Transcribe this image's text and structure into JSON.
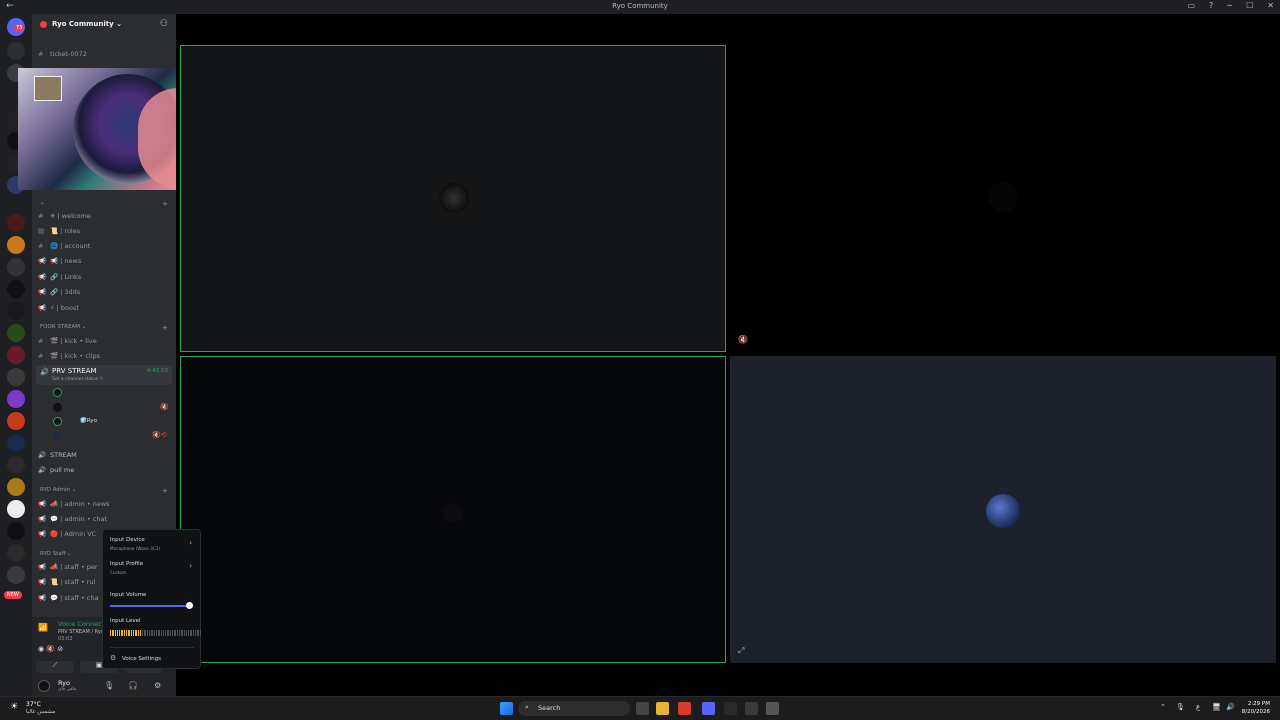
{
  "titlebar": {
    "title": "Ryo Community",
    "back": "←",
    "controls": [
      "▭",
      "?",
      "─",
      "☐",
      "✕"
    ]
  },
  "guild": {
    "name": "Ryo Community ⌄"
  },
  "channels_top": [
    {
      "label": "ticket-0072"
    }
  ],
  "channels_main": [
    {
      "pre": "#",
      "label": "✈ | welcome"
    },
    {
      "pre": "▤",
      "label": "📜 | roles"
    },
    {
      "pre": "#",
      "label": "🌐 | account"
    },
    {
      "pre": "📢",
      "label": "📢 | news"
    },
    {
      "pre": "📢",
      "label": "🔗 | Links"
    },
    {
      "pre": "📢",
      "label": "🔗 | 3dds"
    },
    {
      "pre": "📢",
      "label": "⚡ | boost"
    }
  ],
  "category_stream": {
    "label": "FOOR STREAM ⌄",
    "plus": "+"
  },
  "channels_stream": [
    {
      "pre": "#",
      "label": "🎬 | kick • live"
    },
    {
      "pre": "#",
      "label": "🎬 | kick • clips"
    }
  ],
  "prv_stream": {
    "name": "PRV STREAM",
    "status": "Set a channel status ✎",
    "time": "4:43:03",
    "icon": "🔊"
  },
  "voice_members": [
    {
      "name": ""
    },
    {
      "name": ""
    },
    {
      "name": "🧊Ryo"
    },
    {
      "name": ""
    }
  ],
  "voice_channels": [
    {
      "pre": "🔊",
      "label": "STREAM"
    },
    {
      "pre": "🔊",
      "label": "pull me"
    }
  ],
  "category_admin": {
    "label": "RYO Admin ⌄",
    "plus": "+"
  },
  "channels_admin": [
    {
      "pre": "📢",
      "label": "📣 | admin • news"
    },
    {
      "pre": "📢",
      "label": "💬 | admin • chat"
    },
    {
      "pre": "📢",
      "label": "🔴 | Admin VC"
    }
  ],
  "category_staff": {
    "label": "RYO Staff ⌄"
  },
  "channels_staff": [
    {
      "pre": "📢",
      "label": "📣 | staff • per"
    },
    {
      "pre": "📢",
      "label": "📜 | staff • rul"
    },
    {
      "pre": "📢",
      "label": "💬 | staff • cha"
    }
  ],
  "voice_connected": {
    "title": "Voice Connected",
    "room": "PRV STREAM / Ryo Community",
    "timer": "03:02",
    "buttons": [
      "⟋",
      "▣",
      "✦"
    ]
  },
  "user": {
    "name": "Ryo",
    "status": "مافي فاي",
    "icons": [
      "🎙",
      "🎧",
      "⚙"
    ]
  },
  "server_badges": {
    "ping": "73",
    "new": "NEW"
  },
  "input_menu": {
    "device_label": "Input Device",
    "device_value": "Microphone (Wave 3C3)",
    "profile_label": "Input Profile",
    "profile_value": "Custom",
    "volume_label": "Input Volume",
    "volume_level": 0.96,
    "level_label": "Input Level",
    "level_fraction": 0.35,
    "settings_label": "Voice Settings",
    "arrow": "›",
    "gear": "⚙"
  },
  "stage": {
    "tile_icons": [
      "🔇",
      "⤢"
    ]
  },
  "taskbar": {
    "temp": "37°C",
    "condition": "مشمس غالبا",
    "search_placeholder": "Search",
    "time": "2:29 PM",
    "date": "8/20/2026",
    "tray": [
      "⌃",
      "🎙",
      "ع",
      "🖥",
      "🔊"
    ]
  },
  "colors": {
    "accent": "#23a55a",
    "blurple": "#5865f2",
    "danger": "#f23f43",
    "tile_bg": "#111214",
    "tile_bg_alt": "#1c212b"
  }
}
